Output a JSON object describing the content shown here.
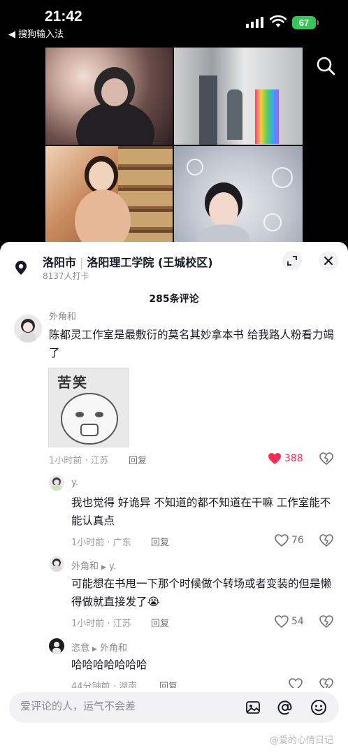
{
  "status_bar": {
    "time": "21:42",
    "back_label": "◀ 搜狗输入法",
    "battery": "67"
  },
  "location": {
    "city": "洛阳市",
    "place": "洛阳理工学院 (王城校区)",
    "checkins": "8137人打卡"
  },
  "comments_count": "285条评论",
  "comments": [
    {
      "user": "外角和",
      "text": "陈都灵工作室是最敷衍的莫名其妙拿本书  给我路人粉看力竭了",
      "sticker_text": "苦笑",
      "time": "1小时前 · 江苏",
      "reply": "回复",
      "likes": "388",
      "liked": true
    }
  ],
  "replies": [
    {
      "user": "y.",
      "reply_to": "",
      "text": "我也觉得 好诡异 不知道的都不知道在干嘛 工作室能不能认真点",
      "time": "1小时前 · 广东",
      "reply": "回复",
      "likes": "76"
    },
    {
      "user": "外角和",
      "reply_to": "y.",
      "text": "可能想在书甩一下那个时候做个转场或者变装的但是懒得做就直接发了😭",
      "time": "1小时前 · 江苏",
      "reply": "回复",
      "likes": "54"
    },
    {
      "user": "恣意",
      "reply_to": "外角和",
      "text": "哈哈哈哈哈哈哈",
      "time": "44分钟前 · 湖南",
      "reply": "回复",
      "likes": ""
    }
  ],
  "input": {
    "placeholder": "爱评论的人，运气不会差"
  },
  "watermark": "@爱的心情日记",
  "colors": {
    "like_red": "#fe2c55",
    "battery_green": "#34c759"
  }
}
